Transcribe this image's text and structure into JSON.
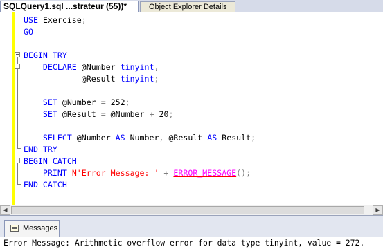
{
  "tabs": {
    "active_label": "SQLQuery1.sql ...strateur (55))*",
    "inactive_label": "Object Explorer Details"
  },
  "code_lines": [
    [
      {
        "t": "USE ",
        "c": "kw"
      },
      {
        "t": "Exercise",
        "c": "id"
      },
      {
        "t": ";",
        "c": "gray"
      }
    ],
    [
      {
        "t": "GO",
        "c": "kw"
      }
    ],
    [],
    [
      {
        "t": "BEGIN TRY",
        "c": "kw"
      }
    ],
    [
      {
        "t": "    DECLARE ",
        "c": "kw"
      },
      {
        "t": "@Number ",
        "c": "id"
      },
      {
        "t": "tinyint",
        "c": "kw"
      },
      {
        "t": ",",
        "c": "gray"
      }
    ],
    [
      {
        "t": "            @Result ",
        "c": "id"
      },
      {
        "t": "tinyint",
        "c": "kw"
      },
      {
        "t": ";",
        "c": "gray"
      }
    ],
    [],
    [
      {
        "t": "    SET ",
        "c": "kw"
      },
      {
        "t": "@Number ",
        "c": "id"
      },
      {
        "t": "= ",
        "c": "gray"
      },
      {
        "t": "252",
        "c": "id"
      },
      {
        "t": ";",
        "c": "gray"
      }
    ],
    [
      {
        "t": "    SET ",
        "c": "kw"
      },
      {
        "t": "@Result ",
        "c": "id"
      },
      {
        "t": "= ",
        "c": "gray"
      },
      {
        "t": "@Number ",
        "c": "id"
      },
      {
        "t": "+ ",
        "c": "gray"
      },
      {
        "t": "20",
        "c": "id"
      },
      {
        "t": ";",
        "c": "gray"
      }
    ],
    [],
    [
      {
        "t": "    SELECT ",
        "c": "kw"
      },
      {
        "t": "@Number ",
        "c": "id"
      },
      {
        "t": "AS ",
        "c": "kw"
      },
      {
        "t": "Number",
        "c": "id"
      },
      {
        "t": ", ",
        "c": "gray"
      },
      {
        "t": "@Result ",
        "c": "id"
      },
      {
        "t": "AS ",
        "c": "kw"
      },
      {
        "t": "Result",
        "c": "id"
      },
      {
        "t": ";",
        "c": "gray"
      }
    ],
    [
      {
        "t": "END TRY",
        "c": "kw"
      }
    ],
    [
      {
        "t": "BEGIN CATCH",
        "c": "kw"
      }
    ],
    [
      {
        "t": "    PRINT ",
        "c": "kw"
      },
      {
        "t": "N'Error Message: '",
        "c": "red"
      },
      {
        "t": " + ",
        "c": "gray"
      },
      {
        "t": "ERROR_MESSAGE",
        "c": "pink und"
      },
      {
        "t": "();",
        "c": "gray"
      }
    ],
    [
      {
        "t": "END CATCH",
        "c": "kw"
      }
    ]
  ],
  "messages_tab_label": "Messages",
  "output_text": "Error Message: Arithmetic overflow error for data type tinyint, value = 272."
}
